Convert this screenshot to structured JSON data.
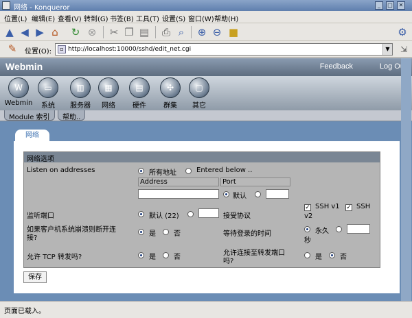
{
  "window": {
    "title": "网络 - Konqueror"
  },
  "menu": [
    "位置(L)",
    "编辑(E)",
    "查看(V)",
    "转到(G)",
    "书签(B)",
    "工具(T)",
    "设置(S)",
    "窗口(W)",
    "帮助(H)"
  ],
  "location": {
    "label": "位置(O):",
    "url": "http://localhost:10000/sshd/edit_net.cgi"
  },
  "banner": {
    "logo": "Webmin",
    "feedback": "Feedback",
    "logout": "Log Out"
  },
  "categories": [
    "Webmin",
    "系统",
    "服务器",
    "网络",
    "硬件",
    "群集",
    "其它"
  ],
  "module_tabs": {
    "index": "Module 索引",
    "help": "帮助.."
  },
  "page_tab": "网络",
  "form": {
    "header": "网络选项",
    "listen": {
      "label": "Listen on addresses",
      "all": "所有地址",
      "entered": "Entered below ..",
      "address_col": "Address",
      "port_col": "Port",
      "port_default": "默认"
    },
    "listen_port": {
      "label": "监听端口",
      "default": "默认 (22)"
    },
    "protocol": {
      "label": "接受协议",
      "ssh_v1": "SSH v1",
      "ssh_v2a": "SSH",
      "ssh_v2b": "v2"
    },
    "disconnect": {
      "label_a": "如果客户机系统崩溃则断开连",
      "label_b": "接?",
      "yes": "是",
      "no": "否"
    },
    "login_wait": {
      "label": "等待登录的时间",
      "forever": "永久",
      "seconds": "秒"
    },
    "tcp_forward": {
      "label": "允许 TCP 转发吗?",
      "yes": "是",
      "no": "否"
    },
    "port_forward": {
      "label_a": "允许连接至转发端口",
      "label_b": "吗?",
      "yes": "是",
      "no": "否"
    },
    "save": "保存"
  },
  "status": "页面已载入。",
  "colors": {
    "accent": "#6b8db5",
    "panel": "#b5b5b5"
  }
}
